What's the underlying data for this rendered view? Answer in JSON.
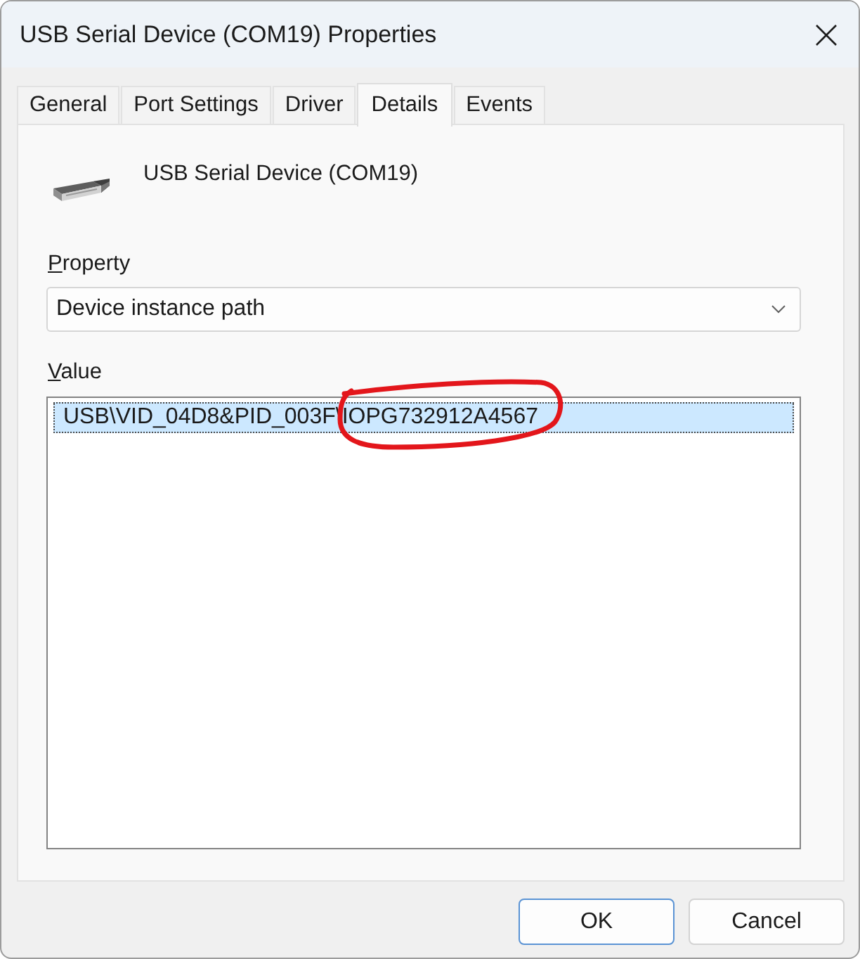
{
  "window": {
    "title": "USB Serial Device (COM19) Properties"
  },
  "tabs": [
    {
      "label": "General",
      "selected": false
    },
    {
      "label": "Port Settings",
      "selected": false
    },
    {
      "label": "Driver",
      "selected": false
    },
    {
      "label": "Details",
      "selected": true
    },
    {
      "label": "Events",
      "selected": false
    }
  ],
  "device": {
    "name": "USB Serial Device (COM19)"
  },
  "property": {
    "label": "Property",
    "value": "Device instance path"
  },
  "value": {
    "label": "Value",
    "items": [
      {
        "text": "USB\\VID_04D8&PID_003F\\IOPG732912A4567",
        "selected": true
      }
    ]
  },
  "buttons": [
    {
      "label": "OK",
      "default": true
    },
    {
      "label": "Cancel",
      "default": false
    }
  ]
}
